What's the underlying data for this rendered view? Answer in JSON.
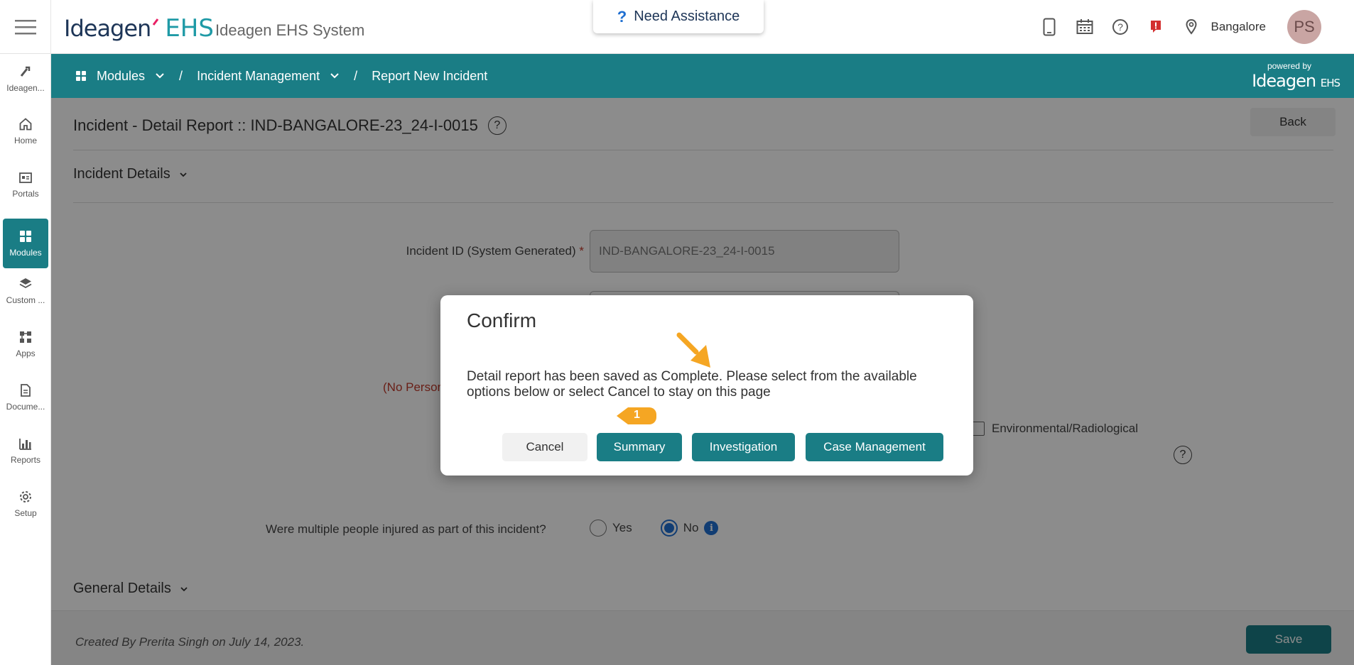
{
  "header": {
    "logo_word": "Ideagen",
    "logo_suffix": "EHS",
    "app_title": "Ideagen EHS System",
    "assist_label": "Need Assistance",
    "location": "Bangalore",
    "avatar_initials": "PS"
  },
  "sidebar": {
    "items": [
      {
        "label": "Ideagen...",
        "icon": "ideagen-icon"
      },
      {
        "label": "Home",
        "icon": "home-icon"
      },
      {
        "label": "Portals",
        "icon": "portals-icon"
      },
      {
        "label": "Modules",
        "icon": "modules-icon"
      },
      {
        "label": "Custom ...",
        "icon": "layers-icon"
      },
      {
        "label": "Apps",
        "icon": "apps-icon"
      },
      {
        "label": "Docume...",
        "icon": "document-icon"
      },
      {
        "label": "Reports",
        "icon": "bar-chart-icon"
      },
      {
        "label": "Setup",
        "icon": "gear-icon"
      }
    ],
    "active_index": 3
  },
  "breadcrumb": {
    "items": [
      "Modules",
      "Incident Management",
      "Report New Incident"
    ],
    "powered_by": "powered by",
    "powered_brand": "Ideagen",
    "powered_brand_suffix": "EHS"
  },
  "page": {
    "title": "Incident - Detail Report :: IND-BANGALORE-23_24-I-0015",
    "back_label": "Back",
    "section_incident_details": "Incident Details",
    "incident_id_label": "Incident ID (System Generated)",
    "incident_id_required": "*",
    "incident_id_value": "IND-BANGALORE-23_24-I-0015",
    "no_person_text": "(No Person",
    "env_radiological_label": "Environmental/Radiological",
    "multi_injured_question": "Were multiple people injured as part of this incident?",
    "radio_yes": "Yes",
    "radio_no": "No",
    "radio_selected": "No",
    "section_general_details": "General Details",
    "created_by": "Created By Prerita Singh on July 14, 2023.",
    "save_label": "Save"
  },
  "dialog": {
    "title": "Confirm",
    "message": "Detail report has been saved as Complete. Please select from the available options below or select Cancel to stay on this page",
    "cancel_label": "Cancel",
    "summary_label": "Summary",
    "investigation_label": "Investigation",
    "case_management_label": "Case Management"
  },
  "annotation": {
    "step_number": "1"
  },
  "colors": {
    "teal": "#1a7d85",
    "brand_blue": "#1f9aa6",
    "required_red": "#c0392b",
    "annotation_orange": "#f5a623"
  }
}
